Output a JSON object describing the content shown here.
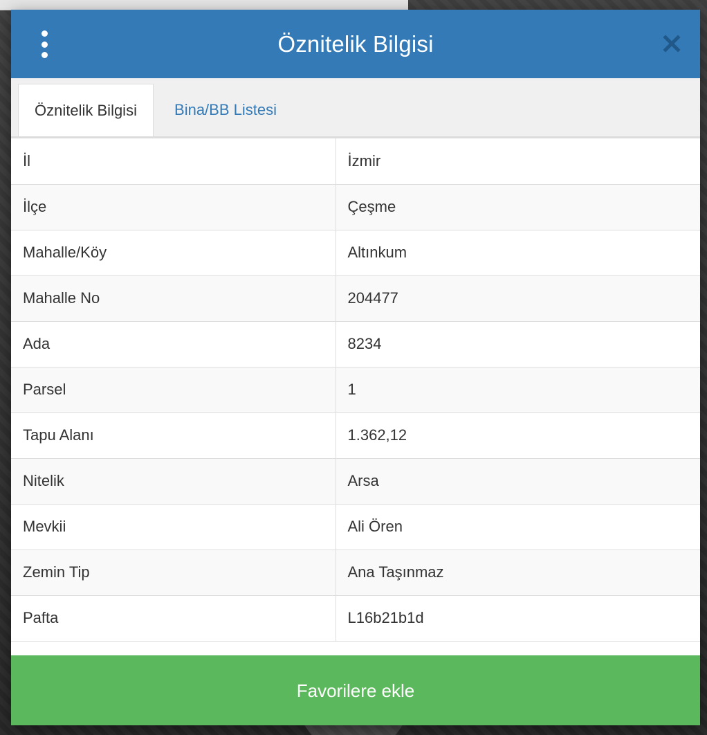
{
  "dialog": {
    "title": "Öznitelik Bilgisi",
    "menu_icon": "vertical-dots-icon",
    "close_icon": "close-icon"
  },
  "tabs": [
    {
      "label": "Öznitelik Bilgisi",
      "active": true
    },
    {
      "label": "Bina/BB Listesi",
      "active": false
    }
  ],
  "attributes": [
    {
      "key": "İl",
      "value": "İzmir"
    },
    {
      "key": "İlçe",
      "value": "Çeşme"
    },
    {
      "key": "Mahalle/Köy",
      "value": "Altınkum"
    },
    {
      "key": "Mahalle No",
      "value": "204477"
    },
    {
      "key": "Ada",
      "value": "8234"
    },
    {
      "key": "Parsel",
      "value": "1"
    },
    {
      "key": "Tapu Alanı",
      "value": "1.362,12"
    },
    {
      "key": "Nitelik",
      "value": "Arsa"
    },
    {
      "key": "Mevkii",
      "value": "Ali Ören"
    },
    {
      "key": "Zemin Tip",
      "value": "Ana Taşınmaz"
    },
    {
      "key": "Pafta",
      "value": "L16b21b1d"
    }
  ],
  "footer": {
    "button_label": "Favorilere ekle"
  },
  "colors": {
    "header": "#337ab7",
    "link": "#337ab7",
    "success": "#5cb85c"
  }
}
